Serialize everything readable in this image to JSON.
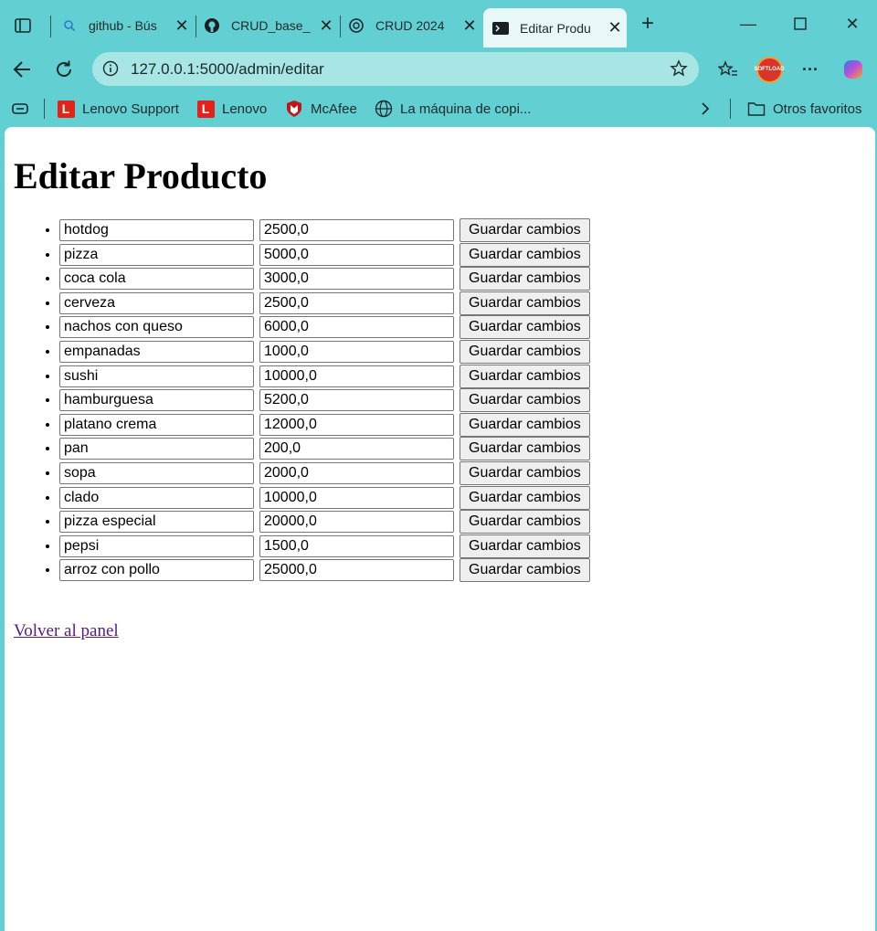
{
  "browser": {
    "tabs": [
      {
        "label": "github - Bús",
        "icon": "search-icon"
      },
      {
        "label": "CRUD_base_",
        "icon": "github-icon"
      },
      {
        "label": "CRUD 2024",
        "icon": "chatgpt-icon"
      },
      {
        "label": "Editar Produ",
        "icon": "terminal-icon"
      }
    ],
    "url": "127.0.0.1:5000/admin/editar",
    "bookmarks": [
      {
        "label": "Lenovo Support",
        "icon": "lenovo-logo-icon"
      },
      {
        "label": "Lenovo",
        "icon": "lenovo-logo-icon"
      },
      {
        "label": "McAfee",
        "icon": "mcafee-icon"
      },
      {
        "label": "La máquina de copi...",
        "icon": "globe-icon"
      }
    ],
    "other_favorites": "Otros favoritos",
    "profile_badge": "SOFTLOAD"
  },
  "page": {
    "title": "Editar Producto",
    "save_label": "Guardar cambios",
    "back_link": "Volver al panel",
    "products": [
      {
        "name": "hotdog",
        "price": "2500,0"
      },
      {
        "name": "pizza",
        "price": "5000,0"
      },
      {
        "name": "coca cola",
        "price": "3000,0"
      },
      {
        "name": "cerveza",
        "price": "2500,0"
      },
      {
        "name": "nachos con queso",
        "price": "6000,0"
      },
      {
        "name": "empanadas",
        "price": "1000,0"
      },
      {
        "name": "sushi",
        "price": "10000,0"
      },
      {
        "name": "hamburguesa",
        "price": "5200,0"
      },
      {
        "name": "platano crema",
        "price": "12000,0"
      },
      {
        "name": "pan",
        "price": "200,0"
      },
      {
        "name": "sopa",
        "price": "2000,0"
      },
      {
        "name": "clado",
        "price": "10000,0"
      },
      {
        "name": "pizza especial",
        "price": "20000,0"
      },
      {
        "name": "pepsi",
        "price": "1500,0"
      },
      {
        "name": "arroz con pollo",
        "price": "25000,0"
      }
    ]
  }
}
